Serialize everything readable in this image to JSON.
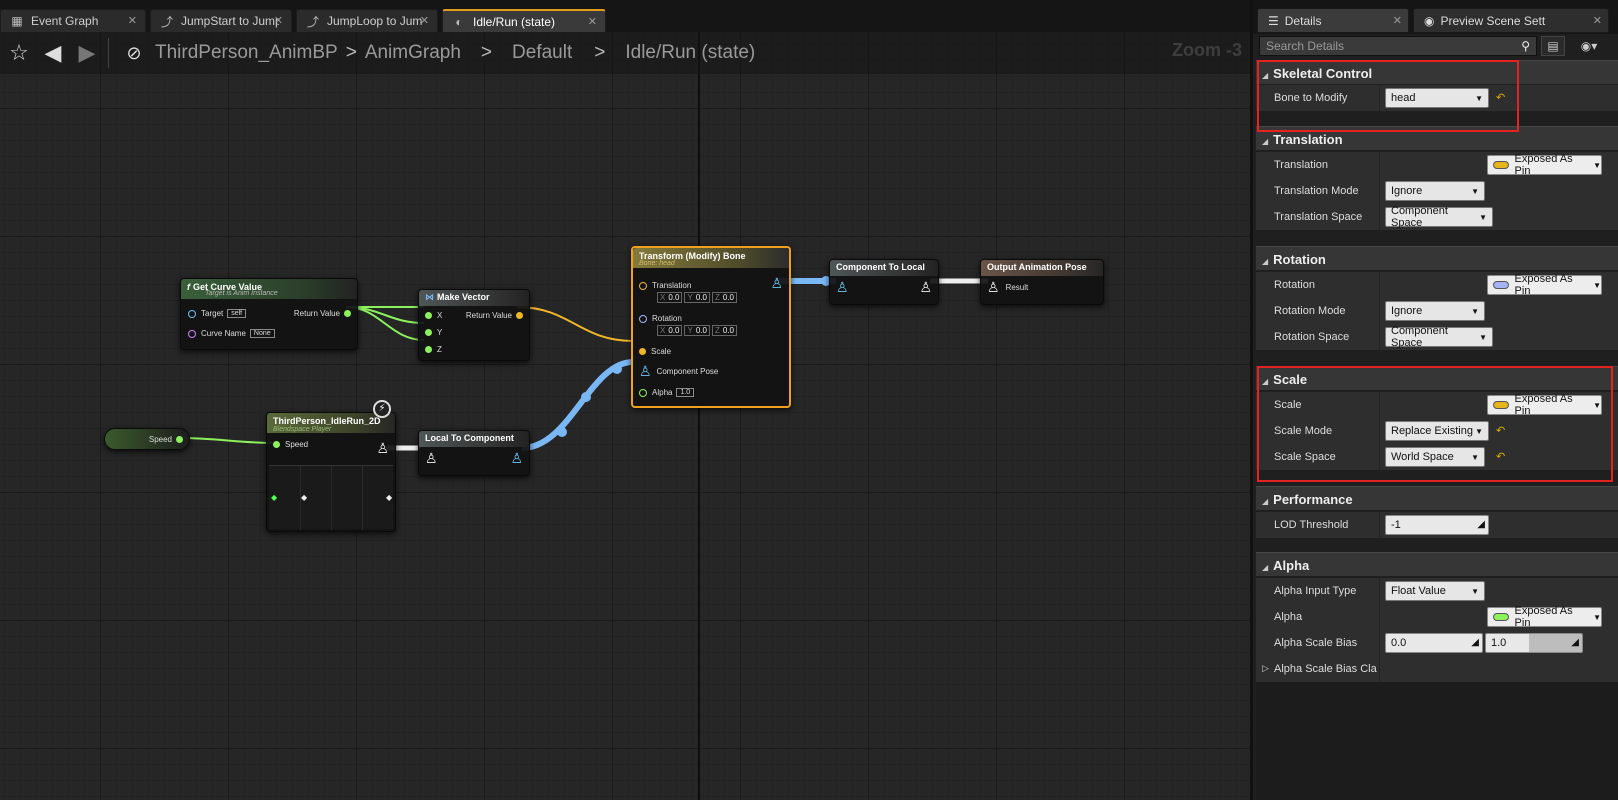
{
  "tabs": [
    {
      "label": "Event Graph",
      "icon": "event-graph-icon"
    },
    {
      "label": "JumpStart to Jump",
      "icon": "transition-icon"
    },
    {
      "label": "JumpLoop to Jum",
      "icon": "transition-icon"
    },
    {
      "label": "Idle/Run (state)",
      "icon": "state-icon",
      "active": true
    }
  ],
  "breadcrumb": [
    "ThirdPerson_AnimBP",
    "AnimGraph",
    "Default",
    "Idle/Run (state)"
  ],
  "breadcrumb_seps": [
    ">",
    ">",
    ">"
  ],
  "zoom": "Zoom -3",
  "nodes": {
    "get_curve": {
      "title": "Get Curve Value",
      "func_glyph": "f",
      "subtitle": "Target is Anim Instance",
      "target": "Target",
      "target_val": "self",
      "curve": "Curve Name",
      "curve_val": "None",
      "ret": "Return Value"
    },
    "make_vector": {
      "title": "Make Vector",
      "x": "X",
      "y": "Y",
      "z": "Z",
      "ret": "Return Value"
    },
    "transform": {
      "title": "Transform (Modify) Bone",
      "subtitle": "Bone: head",
      "translation": "Translation",
      "rotation": "Rotation",
      "axis_x": "X",
      "axis_y": "Y",
      "axis_z": "Z",
      "tx": "0.0",
      "ty": "0.0",
      "tz": "0.0",
      "rx": "0.0",
      "ry": "0.0",
      "rz": "0.0",
      "scale": "Scale",
      "pose": "Component Pose",
      "alpha": "Alpha",
      "alpha_val": "1.0"
    },
    "comp_to_local": {
      "title": "Component To Local"
    },
    "output": {
      "title": "Output Animation Pose",
      "result": "Result"
    },
    "speed": {
      "label": "Speed"
    },
    "blendspace": {
      "title": "ThirdPerson_IdleRun_2D",
      "subtitle": "Blendspace Player",
      "speed": "Speed"
    },
    "local_to_comp": {
      "title": "Local To Component"
    }
  },
  "details": {
    "tabs": [
      "Details",
      "Preview Scene Sett"
    ],
    "search_placeholder": "Search Details",
    "categories": {
      "skeletal": "Skeletal Control",
      "translation": "Translation",
      "rotation": "Rotation",
      "scale": "Scale",
      "performance": "Performance",
      "alpha": "Alpha"
    },
    "rows": {
      "bone_label": "Bone to Modify",
      "bone_val": "head",
      "t_label": "Translation",
      "t_val": "Exposed As Pin",
      "tmode_label": "Translation Mode",
      "tmode_val": "Ignore",
      "tspace_label": "Translation Space",
      "tspace_val": "Component Space",
      "r_label": "Rotation",
      "r_val": "Exposed As Pin",
      "rmode_label": "Rotation Mode",
      "rmode_val": "Ignore",
      "rspace_label": "Rotation Space",
      "rspace_val": "Component Space",
      "s_label": "Scale",
      "s_val": "Exposed As Pin",
      "smode_label": "Scale Mode",
      "smode_val": "Replace Existing",
      "sspace_label": "Scale Space",
      "sspace_val": "World Space",
      "lod_label": "LOD Threshold",
      "lod_val": "-1",
      "ait_label": "Alpha Input Type",
      "ait_val": "Float Value",
      "a_label": "Alpha",
      "a_val": "Exposed As Pin",
      "asb_label": "Alpha Scale Bias",
      "asb_min": "0.0",
      "asb_max": "1.0",
      "asbc_label": "Alpha Scale Bias Cla"
    },
    "colors": {
      "translation_pin": "#e5b51c",
      "rotation_pin": "#a6b3f5",
      "scale_pin": "#e5b51c",
      "alpha_pin": "#8cf15d",
      "highlight": "#e32222"
    }
  }
}
